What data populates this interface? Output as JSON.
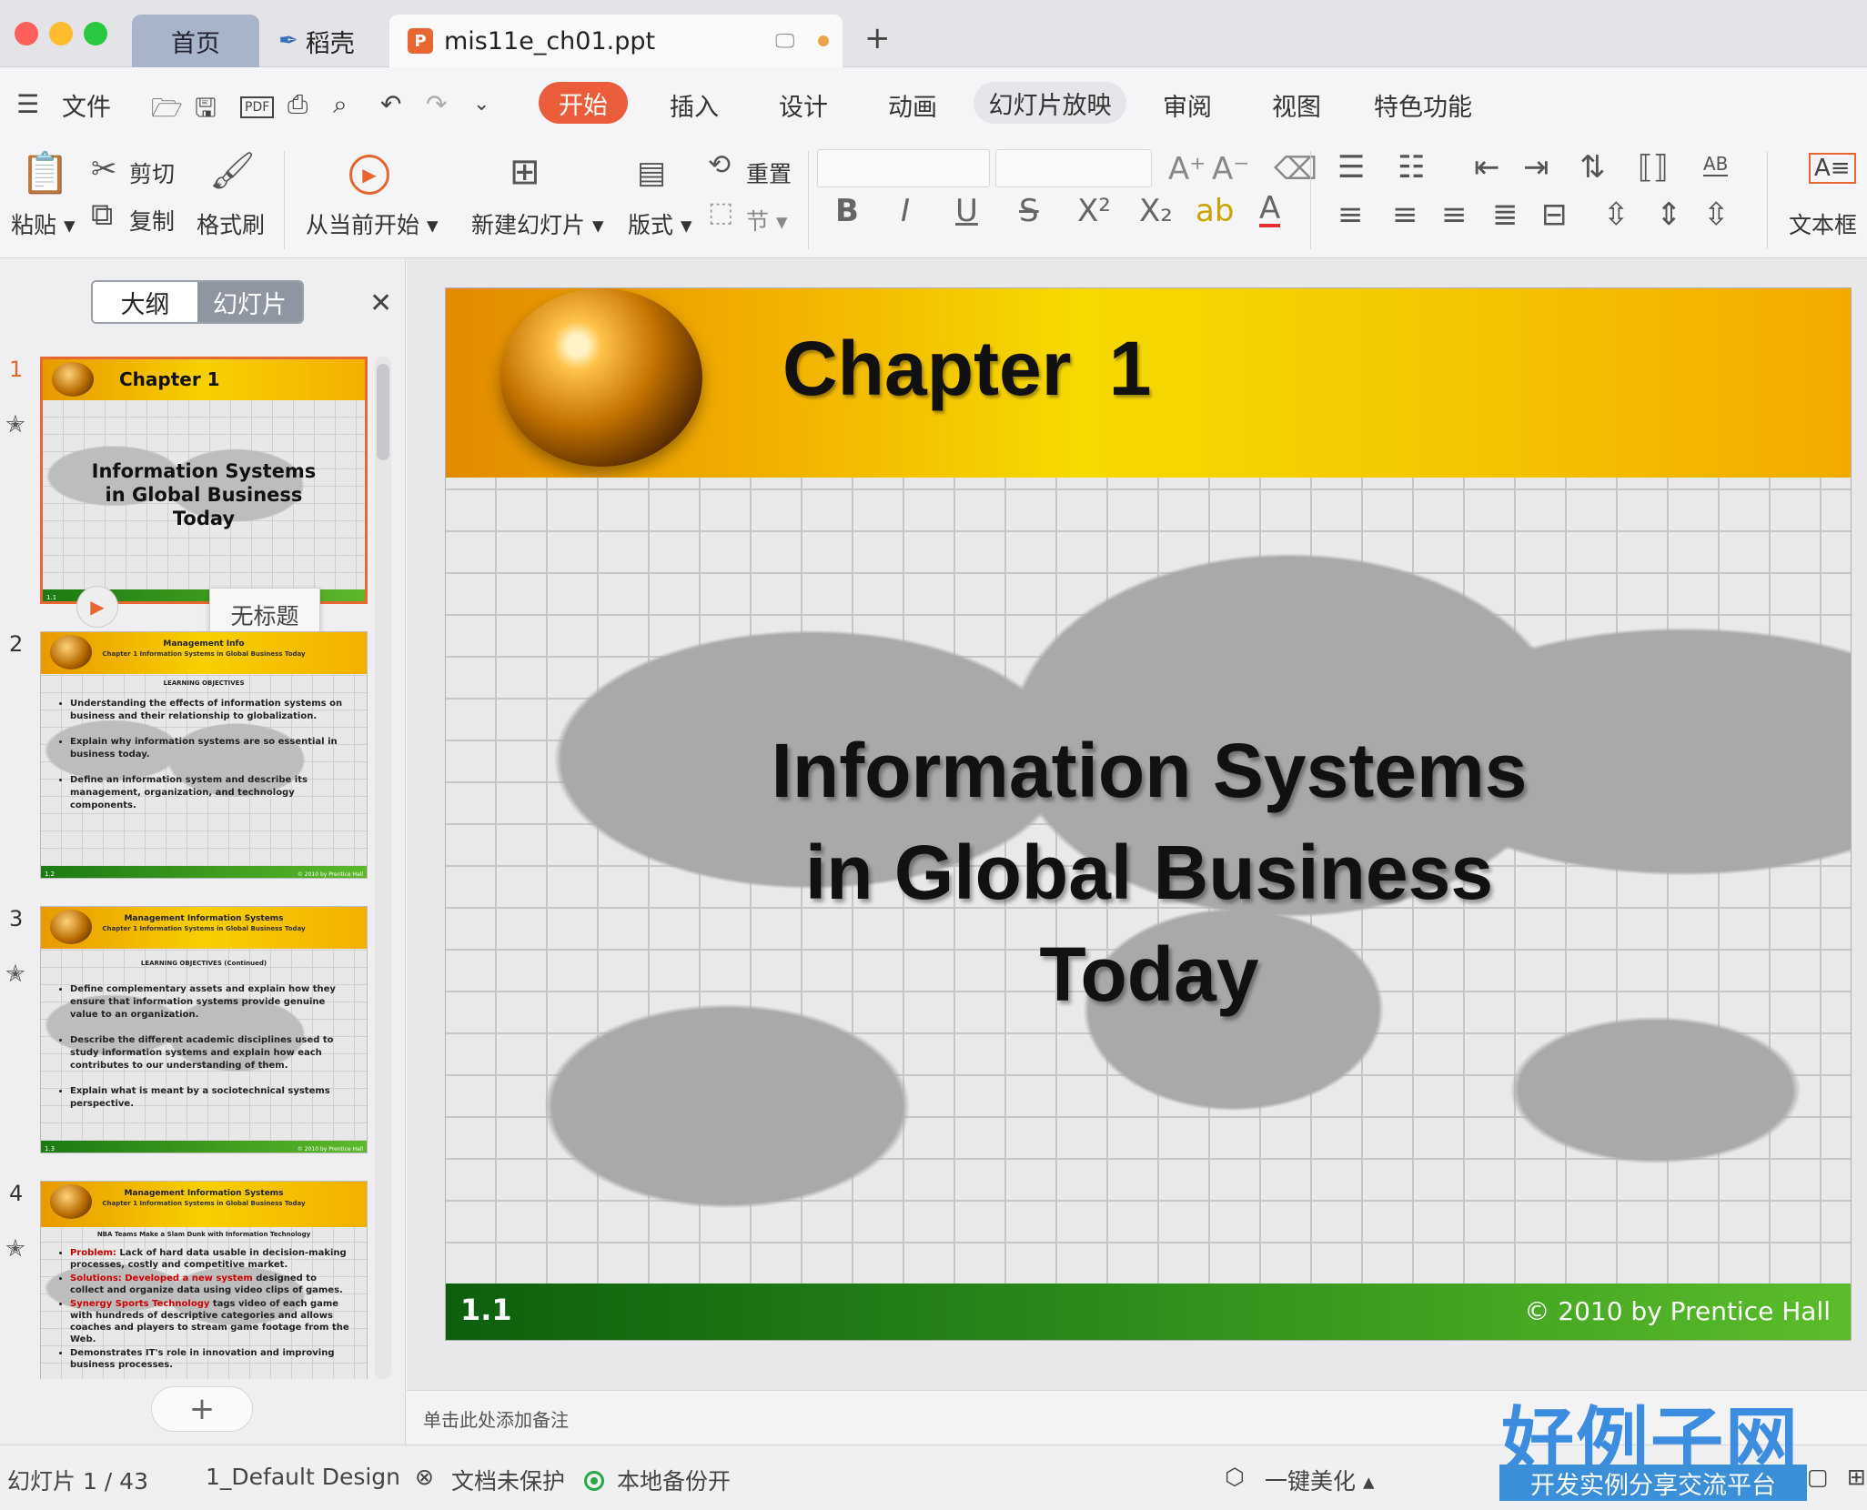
{
  "tabs": {
    "home": "首页",
    "daoke": "稻壳",
    "file": "mis11e_ch01.ppt",
    "add": "+"
  },
  "menu": {
    "file": "文件",
    "start": "开始",
    "insert": "插入",
    "design": "设计",
    "animation": "动画",
    "slideshow": "幻灯片放映",
    "review": "审阅",
    "view": "视图",
    "special": "特色功能"
  },
  "ribbon": {
    "paste": "粘贴",
    "cut": "剪切",
    "copy": "复制",
    "format_painter": "格式刷",
    "from_current": "从当前开始",
    "new_slide": "新建幻灯片",
    "layout": "版式",
    "reset": "重置",
    "section": "节",
    "textbox": "文本框"
  },
  "panel": {
    "outline": "大纲",
    "slides": "幻灯片",
    "tooltip": "无标题",
    "add": "+"
  },
  "thumbnails": [
    {
      "num": "1",
      "title": "Chapter 1",
      "subtitle_lines": [
        "Information Systems",
        "in Global Business",
        "Today"
      ],
      "footer_num": "1.1"
    },
    {
      "num": "2",
      "header1": "Management Info",
      "header2": "Chapter 1 Information Systems in Global Business Today",
      "section": "LEARNING OBJECTIVES",
      "bullets": [
        "Understanding the effects of information systems on business and their relationship to globalization.",
        "Explain why information systems are so essential in business today.",
        "Define an information system and describe its management, organization, and technology components."
      ],
      "footer_num": "1.2",
      "footer_cr": "© 2010 by Prentice Hall"
    },
    {
      "num": "3",
      "header1": "Management Information Systems",
      "header2": "Chapter 1 Information Systems in Global Business Today",
      "section": "LEARNING OBJECTIVES (Continued)",
      "bullets": [
        "Define complementary assets and explain how they ensure that information systems provide genuine value to an organization.",
        "Describe the different academic disciplines used to study information systems and explain how each contributes to our understanding of them.",
        "Explain what is meant by a sociotechnical systems perspective."
      ],
      "footer_num": "1.3",
      "footer_cr": "© 2010 by Prentice Hall"
    },
    {
      "num": "4",
      "header1": "Management Information Systems",
      "header2": "Chapter 1 Information Systems in Global Business Today",
      "section": "NBA Teams Make a Slam Dunk with Information Technology",
      "b1_label": "Problem:",
      "b1_text": " Lack of hard data usable in decision-making processes, costly and competitive market.",
      "b2_label": "Solutions: Developed a new system",
      "b2_text": " designed to collect and organize data using video clips of games.",
      "b3_label": "Synergy Sports Technology",
      "b3_text": " tags video of each game with hundreds of descriptive categories and allows coaches and players to stream game footage from the Web.",
      "b4_text": "Demonstrates IT's role in innovation and improving business processes."
    }
  ],
  "slide": {
    "chapter": "Chapter 1",
    "subtitle_lines": [
      "Information Systems",
      "in Global Business",
      "Today"
    ],
    "footer_num": "1.1",
    "footer_cr": "© 2010 by Prentice Hall"
  },
  "notes_placeholder": "单击此处添加备注",
  "status": {
    "slide_count": "幻灯片 1 / 43",
    "design": "1_Default Design",
    "protect": "文档未保护",
    "backup": "本地备份开",
    "beautify": "一键美化"
  },
  "watermark": {
    "logo": "好例子网",
    "tagline": "开发实例分享交流平台"
  },
  "colors": {
    "accent": "#ea5c3a",
    "close": "#ff5f57",
    "minimize": "#febc2e",
    "zoom": "#28c840"
  }
}
